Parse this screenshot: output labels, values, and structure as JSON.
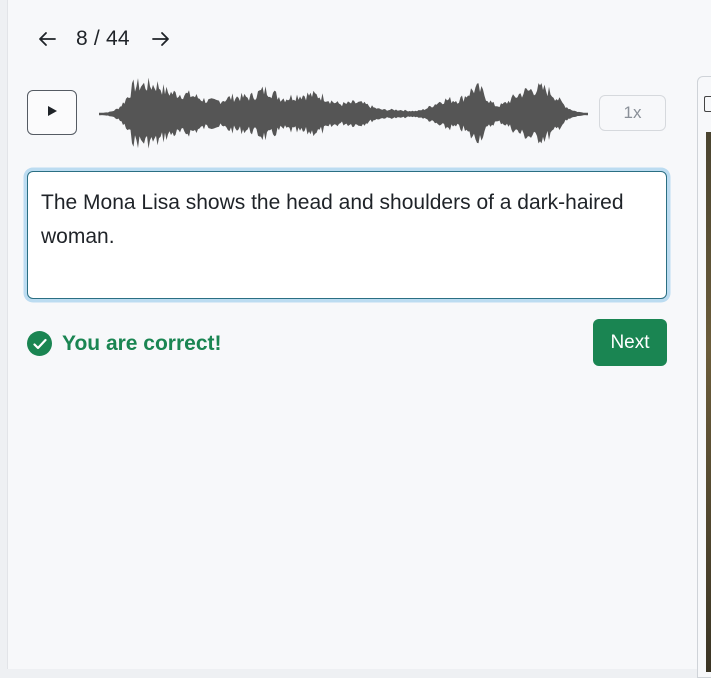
{
  "pager": {
    "current": "8",
    "separator": "/",
    "total": "44",
    "text": "8 / 44",
    "prev_icon": "arrow-left-icon",
    "next_icon": "arrow-right-icon"
  },
  "player": {
    "play_icon": "play-icon",
    "speed_label": "1x"
  },
  "answer": {
    "text": "The Mona Lisa shows the head and shoulders of a dark-haired woman."
  },
  "feedback": {
    "icon": "check-circle-icon",
    "message": "You are correct!",
    "color": "#1a8552"
  },
  "actions": {
    "next_label": "Next"
  },
  "colors": {
    "accent": "#1a8552",
    "focus_ring": "#bcdcf1",
    "waveform": "#555555"
  }
}
